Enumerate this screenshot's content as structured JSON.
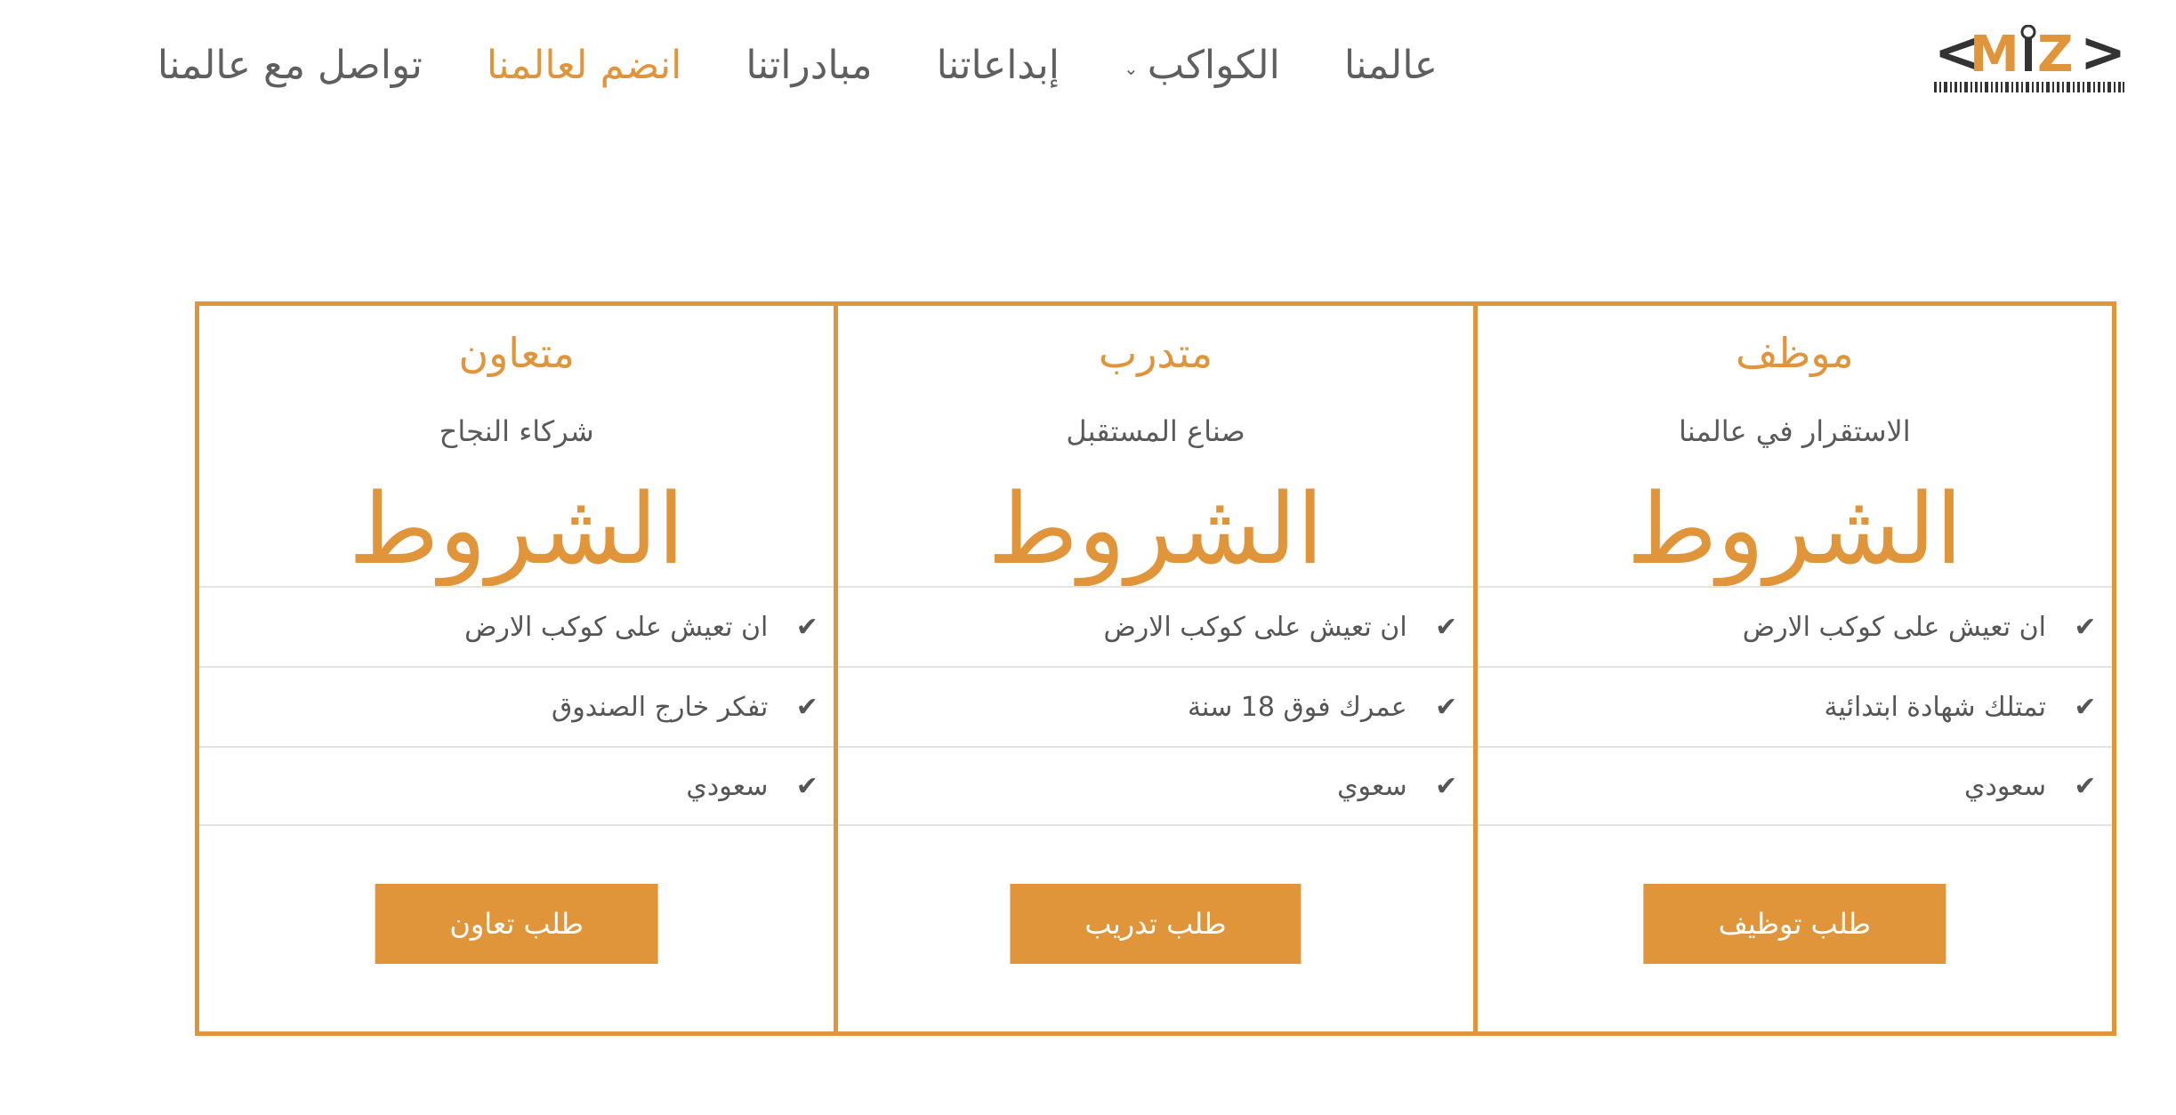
{
  "brand": {
    "logo_text": "<MIZ>"
  },
  "nav": {
    "items": [
      {
        "label": "عالمنا"
      },
      {
        "label": "الكواكب",
        "dropdown": true
      },
      {
        "label": "إبداعاتنا"
      },
      {
        "label": "مبادراتنا"
      },
      {
        "label": "انضم لعالمنا",
        "active": true
      },
      {
        "label": "تواصل مع عالمنا"
      }
    ]
  },
  "colors": {
    "accent": "#e0953a",
    "text": "#555555",
    "divider": "#e3e3e3"
  },
  "plans": [
    {
      "title": "موظف",
      "subtitle": "الاستقرار في عالمنا",
      "heading": "الشروط",
      "features": [
        "ان تعيش على كوكب الارض",
        "تمتلك شهادة ابتدائية",
        "سعودي"
      ],
      "button": "طلب توظيف"
    },
    {
      "title": "متدرب",
      "subtitle": "صناع المستقبل",
      "heading": "الشروط",
      "features": [
        "ان تعيش على كوكب الارض",
        "عمرك فوق 18 سنة",
        "سعوي"
      ],
      "button": "طلب تدريب"
    },
    {
      "title": "متعاون",
      "subtitle": "شركاء النجاح",
      "heading": "الشروط",
      "features": [
        "ان تعيش على كوكب الارض",
        "تفكر خارج الصندوق",
        "سعودي"
      ],
      "button": "طلب تعاون"
    }
  ]
}
